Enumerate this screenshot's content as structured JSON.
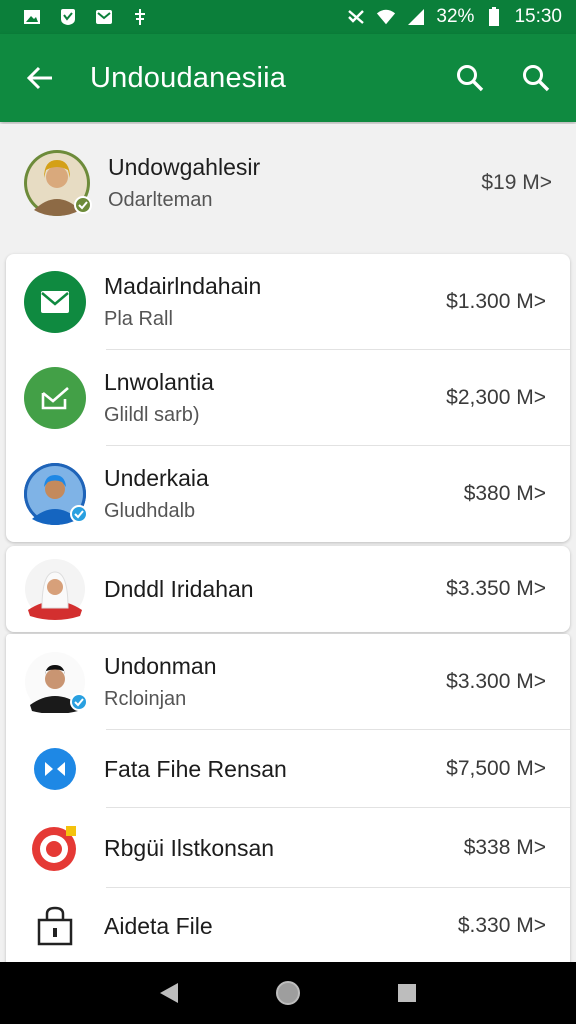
{
  "status_bar": {
    "battery": "32%",
    "time": "15:30",
    "icons": [
      "image-icon",
      "shield-icon",
      "mail-icon",
      "android-icon",
      "mute-icon",
      "wifi-icon",
      "signal-icon",
      "battery-icon"
    ]
  },
  "app_bar": {
    "title": "Undoudanesiia",
    "back_icon": "arrow-back-icon",
    "actions": [
      "search-icon",
      "search-icon"
    ]
  },
  "profile": {
    "name": "Undowgahlesir",
    "subtitle": "Odarlteman",
    "amount": "$19 M>"
  },
  "card1": {
    "items": [
      {
        "title": "Madairlndahain",
        "subtitle": "Pla Rall",
        "amount": "$1.300 M>",
        "icon": "mail-icon",
        "color": "#0f8a40"
      },
      {
        "title": "Lnwolantia",
        "subtitle": "Glildl sarb)",
        "amount": "$2,300 M>",
        "icon": "edit-mail-icon",
        "color": "#43a047"
      },
      {
        "title": "Underkaia",
        "subtitle": "Gludhdalb",
        "amount": "$380 M>",
        "icon": "avatar",
        "color": "#1e63b8"
      }
    ]
  },
  "card2": {
    "items": [
      {
        "title": "Dnddl Iridahan",
        "subtitle": "",
        "amount": "$3.350 M>",
        "icon": "avatar",
        "color": "#d32f2f"
      }
    ]
  },
  "card3": {
    "items": [
      {
        "title": "Undonman",
        "subtitle": "Rcloinjan",
        "amount": "$3.300 M>",
        "icon": "avatar",
        "color": "#111111"
      },
      {
        "title": "Fata Fihe Rensan",
        "subtitle": "",
        "amount": "$7,500 M>",
        "icon": "bowtie-icon",
        "color": "#1e88e5"
      },
      {
        "title": "Rbgüi Ilstkonsan",
        "subtitle": "",
        "amount": "$338 M>",
        "icon": "target-icon",
        "color": "#e53935"
      },
      {
        "title": "Aideta File",
        "subtitle": "",
        "amount": "$.330 M>",
        "icon": "lock-icon",
        "color": "#222222"
      }
    ]
  },
  "nav_bar": {
    "buttons": [
      "back-triangle-icon",
      "home-circle-icon",
      "recents-square-icon"
    ]
  }
}
